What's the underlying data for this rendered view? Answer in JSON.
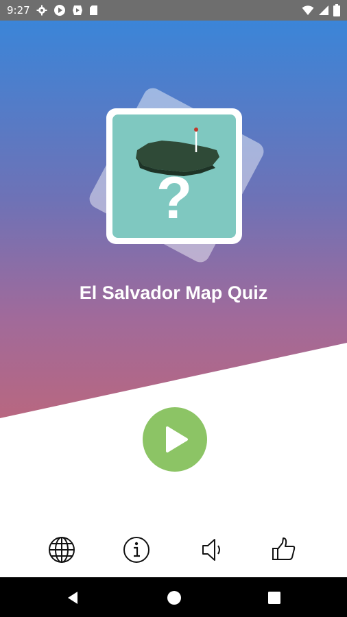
{
  "status_bar": {
    "time": "9:27",
    "left_icons": [
      "settings-icon",
      "play-store-icon",
      "media-icon",
      "sd-card-icon"
    ],
    "right_icons": [
      "wifi-icon",
      "signal-icon",
      "battery-icon"
    ]
  },
  "app": {
    "title": "El Salvador Map Quiz",
    "logo_symbol": "?",
    "colors": {
      "gradient_top": "#3b85d8",
      "gradient_bottom": "#b86780",
      "logo_bg": "#7fc8c0",
      "play": "#8cc465"
    }
  },
  "actions": {
    "play": "play-icon",
    "bottom": [
      "globe-icon",
      "info-icon",
      "sound-icon",
      "thumbs-up-icon"
    ]
  },
  "nav": [
    "back-icon",
    "home-icon",
    "recents-icon"
  ]
}
